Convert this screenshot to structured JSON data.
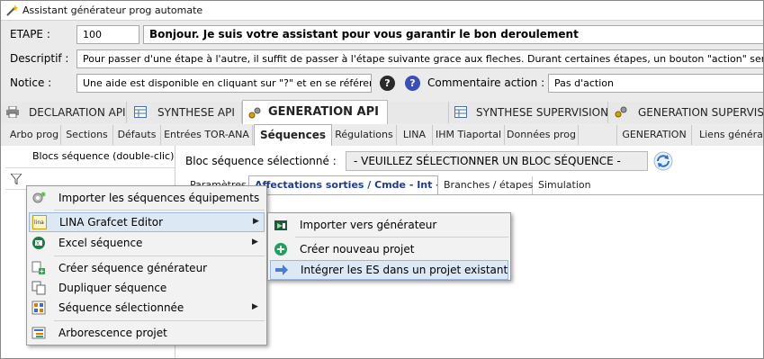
{
  "window": {
    "title": "Assistant générateur prog automate"
  },
  "info": {
    "etape_label": "ETAPE :",
    "etape_value": "100",
    "etape_message": "Bonjour. Je suis votre assistant pour vous garantir le bon deroulement",
    "descriptif_label": "Descriptif :",
    "descriptif_value": "Pour passer d'une étape à l'autre, il suffit de passer à l'étape suivante grace aux fleches. Durant certaines étapes, un bouton \"action\" sera dis",
    "notice_label": "Notice :",
    "notice_value": "Une aide est disponible en cliquant sur \"?\" et en se référenç",
    "help_glyph": "?",
    "commentaire_label": "Commentaire action :",
    "commentaire_value": "Pas d'action"
  },
  "main_tabs": [
    {
      "label": "DECLARATION API",
      "icon": "printer-icon"
    },
    {
      "label": "SYNTHESE API",
      "icon": "table-icon"
    },
    {
      "label": "GENERATION API",
      "icon": "gears-icon",
      "active": true
    },
    {
      "label": "SYNTHESE SUPERVISION",
      "icon": "table-icon"
    },
    {
      "label": "GENERATION SUPERVISIO",
      "icon": "gears-icon"
    }
  ],
  "sub_tabs": [
    {
      "label": "Arbo prog"
    },
    {
      "label": "Sections"
    },
    {
      "label": "Défauts"
    },
    {
      "label": "Entrées TOR-ANA"
    },
    {
      "label": "Séquences",
      "active": true
    },
    {
      "label": "Régulations"
    },
    {
      "label": "LINA"
    },
    {
      "label": "IHM Tiaportal"
    },
    {
      "label": "Données prog"
    },
    {
      "label": "GENERATION"
    },
    {
      "label": "Liens générati"
    }
  ],
  "left_pane": {
    "header": "Blocs séquence (double-clic)"
  },
  "bloc": {
    "label": "Bloc séquence sélectionné :",
    "value": "- VEUILLEZ SÉLECTIONNER UN BLOC SÉQUENCE -"
  },
  "inner_tabs": [
    {
      "label": "Paramètres"
    },
    {
      "label": "Affectations sorties / Cmde - Int - ...",
      "active": true
    },
    {
      "label": "Branches / étapes"
    },
    {
      "label": "Simulation"
    }
  ],
  "context_menu": {
    "items": [
      {
        "label": "Importer les séquences équipements",
        "icon": "gear-icon"
      },
      {
        "label": "LINA Grafcet Editor",
        "icon": "lina-icon",
        "submenu": true,
        "highlighted": true
      },
      {
        "label": "Excel séquence",
        "icon": "excel-icon",
        "submenu": true
      },
      {
        "label": "Créer séquence générateur",
        "icon": "create-sequence-icon"
      },
      {
        "label": "Dupliquer séquence",
        "icon": "duplicate-icon"
      },
      {
        "label": "Séquence sélectionnée",
        "icon": "selected-sequence-icon",
        "submenu": true
      },
      {
        "label": "Arborescence projet",
        "icon": "tree-icon"
      }
    ]
  },
  "sub_menu": {
    "items": [
      {
        "label": "Importer vers générateur",
        "icon": "import-icon"
      },
      {
        "label": "Créer nouveau projet",
        "icon": "plus-circle-icon"
      },
      {
        "label": "Intégrer les ES dans un projet existant",
        "icon": "arrow-right-icon",
        "highlighted": true
      }
    ]
  },
  "colors": {
    "accent_blue": "#1c3c9a",
    "highlight_bg": "#dde8f5",
    "help_dark": "#2a2a2a",
    "help_blue": "#3b4fb8",
    "green_plus": "#1fa15a"
  }
}
